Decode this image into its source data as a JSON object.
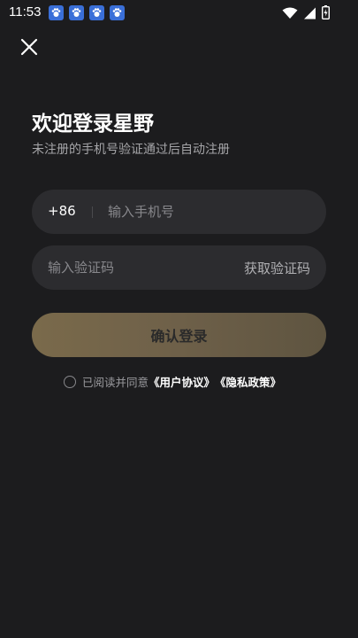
{
  "status_bar": {
    "time": "11:53",
    "notification_icons": [
      "baidu-paw-icon",
      "baidu-paw-icon",
      "baidu-paw-icon",
      "baidu-paw-icon"
    ],
    "system_icons": [
      "wifi-icon",
      "cellular-signal-icon",
      "battery-charging-icon"
    ]
  },
  "header": {
    "close_icon": "close-icon"
  },
  "login": {
    "title": "欢迎登录星野",
    "subtitle": "未注册的手机号验证通过后自动注册",
    "country_code": "+86",
    "phone_placeholder": "输入手机号",
    "code_placeholder": "输入验证码",
    "get_code_label": "获取验证码",
    "submit_label": "确认登录"
  },
  "agreement": {
    "prefix": "已阅读并同意",
    "user_agreement": "《用户协议》",
    "privacy_policy": "《隐私政策》"
  },
  "colors": {
    "background": "#1c1c1e",
    "field_background": "#2c2c2f",
    "button_gradient_start": "#7a6a4b",
    "button_gradient_end": "#5e5440",
    "muted_text": "#a5a5a8"
  }
}
